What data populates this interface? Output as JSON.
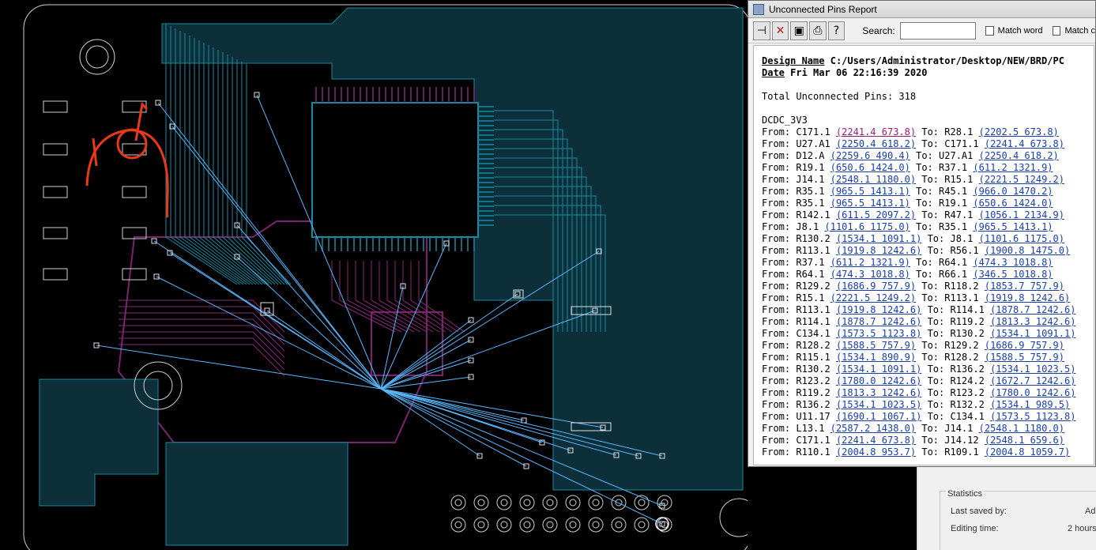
{
  "window": {
    "title": "Unconnected Pins Report"
  },
  "toolbar": {
    "pin_icon": "pin-icon",
    "close_icon": "close-icon",
    "save_icon": "save-icon",
    "print_icon": "print-icon",
    "help_icon": "help-icon",
    "search_label": "Search:",
    "search_value": "",
    "match_word_label": "Match word",
    "match_case_label": "Match c"
  },
  "report": {
    "design_label": "Design Name",
    "design_value": "C:/Users/Administrator/Desktop/NEW/BRD/PC",
    "date_label": "Date",
    "date_value": "Fri Mar 06 22:16:39 2020",
    "total_line": "Total Unconnected Pins: 318",
    "net_name": "DCDC_3V3",
    "rows": [
      {
        "from_label": "From:",
        "from": "C171.1",
        "from_coord": "(2241.4 673.8)",
        "to_label": "To:",
        "to": "R28.1",
        "to_coord": "(2202.5 673.8)"
      },
      {
        "from_label": "From:",
        "from": "U27.A1",
        "from_coord": "(2250.4 618.2)",
        "to_label": "To:",
        "to": "C171.1",
        "to_coord": "(2241.4 673.8)"
      },
      {
        "from_label": "From:",
        "from": "D12.A",
        "from_coord": "(2259.6 490.4)",
        "to_label": "To:",
        "to": "U27.A1",
        "to_coord": "(2250.4 618.2)"
      },
      {
        "from_label": "From:",
        "from": "R19.1",
        "from_coord": "(650.6 1424.0)",
        "to_label": "To:",
        "to": "R37.1",
        "to_coord": "(611.2 1321.9)"
      },
      {
        "from_label": "From:",
        "from": "J14.1",
        "from_coord": "(2548.1 1180.0)",
        "to_label": "To:",
        "to": "R15.1",
        "to_coord": "(2221.5 1249.2)"
      },
      {
        "from_label": "From:",
        "from": "R35.1",
        "from_coord": "(965.5 1413.1)",
        "to_label": "To:",
        "to": "R45.1",
        "to_coord": "(966.0 1470.2)"
      },
      {
        "from_label": "From:",
        "from": "R35.1",
        "from_coord": "(965.5 1413.1)",
        "to_label": "To:",
        "to": "R19.1",
        "to_coord": "(650.6 1424.0)"
      },
      {
        "from_label": "From:",
        "from": "R142.1",
        "from_coord": "(611.5 2097.2)",
        "to_label": "To:",
        "to": "R47.1",
        "to_coord": "(1056.1 2134.9)"
      },
      {
        "from_label": "From:",
        "from": "J8.1",
        "from_coord": "(1101.6 1175.0)",
        "to_label": "To:",
        "to": "R35.1",
        "to_coord": "(965.5 1413.1)"
      },
      {
        "from_label": "From:",
        "from": "R130.2",
        "from_coord": "(1534.1 1091.1)",
        "to_label": "To:",
        "to": "J8.1",
        "to_coord": "(1101.6 1175.0)"
      },
      {
        "from_label": "From:",
        "from": "R113.1",
        "from_coord": "(1919.8 1242.6)",
        "to_label": "To:",
        "to": "R56.1",
        "to_coord": "(1900.8 1475.0)"
      },
      {
        "from_label": "From:",
        "from": "R37.1",
        "from_coord": "(611.2 1321.9)",
        "to_label": "To:",
        "to": "R64.1",
        "to_coord": "(474.3 1018.8)"
      },
      {
        "from_label": "From:",
        "from": "R64.1",
        "from_coord": "(474.3 1018.8)",
        "to_label": "To:",
        "to": "R66.1",
        "to_coord": "(346.5 1018.8)"
      },
      {
        "from_label": "From:",
        "from": "R129.2",
        "from_coord": "(1686.9 757.9)",
        "to_label": "To:",
        "to": "R118.2",
        "to_coord": "(1853.7 757.9)"
      },
      {
        "from_label": "From:",
        "from": "R15.1",
        "from_coord": "(2221.5 1249.2)",
        "to_label": "To:",
        "to": "R113.1",
        "to_coord": "(1919.8 1242.6)"
      },
      {
        "from_label": "From:",
        "from": "R113.1",
        "from_coord": "(1919.8 1242.6)",
        "to_label": "To:",
        "to": "R114.1",
        "to_coord": "(1878.7 1242.6)"
      },
      {
        "from_label": "From:",
        "from": "R114.1",
        "from_coord": "(1878.7 1242.6)",
        "to_label": "To:",
        "to": "R119.2",
        "to_coord": "(1813.3 1242.6)"
      },
      {
        "from_label": "From:",
        "from": "C134.1",
        "from_coord": "(1573.5 1123.8)",
        "to_label": "To:",
        "to": "R130.2",
        "to_coord": "(1534.1 1091.1)"
      },
      {
        "from_label": "From:",
        "from": "R128.2",
        "from_coord": "(1588.5 757.9)",
        "to_label": "To:",
        "to": "R129.2",
        "to_coord": "(1686.9 757.9)"
      },
      {
        "from_label": "From:",
        "from": "R115.1",
        "from_coord": "(1534.1 890.9)",
        "to_label": "To:",
        "to": "R128.2",
        "to_coord": "(1588.5 757.9)"
      },
      {
        "from_label": "From:",
        "from": "R130.2",
        "from_coord": "(1534.1 1091.1)",
        "to_label": "To:",
        "to": "R136.2",
        "to_coord": "(1534.1 1023.5)"
      },
      {
        "from_label": "From:",
        "from": "R123.2",
        "from_coord": "(1780.0 1242.6)",
        "to_label": "To:",
        "to": "R124.2",
        "to_coord": "(1672.7 1242.6)"
      },
      {
        "from_label": "From:",
        "from": "R119.2",
        "from_coord": "(1813.3 1242.6)",
        "to_label": "To:",
        "to": "R123.2",
        "to_coord": "(1780.0 1242.6)"
      },
      {
        "from_label": "From:",
        "from": "R136.2",
        "from_coord": "(1534.1 1023.5)",
        "to_label": "To:",
        "to": "R132.2",
        "to_coord": "(1534.1 989.5)"
      },
      {
        "from_label": "From:",
        "from": "U11.17",
        "from_coord": "(1690.1 1067.1)",
        "to_label": "To:",
        "to": "C134.1",
        "to_coord": "(1573.5 1123.8)"
      },
      {
        "from_label": "From:",
        "from": "L13.1",
        "from_coord": "(2587.2 1438.0)",
        "to_label": "To:",
        "to": "J14.1",
        "to_coord": "(2548.1 1180.0)"
      },
      {
        "from_label": "From:",
        "from": "C171.1",
        "from_coord": "(2241.4 673.8)",
        "to_label": "To:",
        "to": "J14.12",
        "to_coord": "(2548.1 659.6)"
      },
      {
        "from_label": "From:",
        "from": "R110.1",
        "from_coord": "(2004.8 953.7)",
        "to_label": "To:",
        "to": "R109.1",
        "to_coord": "(2004.8 1059.7)"
      }
    ]
  },
  "doc_panel": {
    "statistics_title": "Statistics",
    "last_saved_label": "Last saved by:",
    "last_saved_value": "Ad",
    "editing_time_label": "Editing time:",
    "editing_time_value": "2 hours"
  },
  "colors": {
    "trace_cyan": "#1a8aa0",
    "trace_magenta": "#8a2a78",
    "ratsnest": "#5ab8ff",
    "pcb_outline": "#e0e0e0",
    "annotation_red": "#e83a1a"
  }
}
